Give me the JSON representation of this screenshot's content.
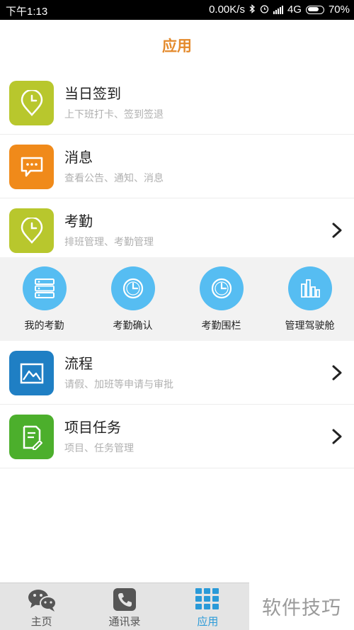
{
  "status_bar": {
    "time": "下午1:13",
    "network_speed": "0.00K/s",
    "network_type": "4G",
    "battery": "70%",
    "icons": [
      "bluetooth-icon",
      "alarm-icon",
      "signal-icon",
      "battery-icon"
    ]
  },
  "header": {
    "title": "应用"
  },
  "colors": {
    "title": "#e48a2c",
    "lime_icon": "#b8c72d",
    "orange_icon": "#f08a1a",
    "blue_icon": "#1f7fc4",
    "green_icon": "#4caf2c",
    "grid_circle": "#56bdf2",
    "nav_active": "#2a9ad8"
  },
  "list_top": [
    {
      "title": "当日签到",
      "subtitle": "上下班打卡、签到签退",
      "icon": "location-clock-icon",
      "has_chevron": false
    },
    {
      "title": "消息",
      "subtitle": "查看公告、通知、消息",
      "icon": "message-icon",
      "has_chevron": false
    },
    {
      "title": "考勤",
      "subtitle": "排班管理、考勤管理",
      "icon": "location-clock-icon",
      "has_chevron": true
    }
  ],
  "grid": [
    {
      "label": "我的考勤",
      "icon": "server-list-icon"
    },
    {
      "label": "考勤确认",
      "icon": "clock-icon"
    },
    {
      "label": "考勤围栏",
      "icon": "clock-icon"
    },
    {
      "label": "管理驾驶舱",
      "icon": "bar-chart-icon"
    }
  ],
  "list_bottom": [
    {
      "title": "流程",
      "subtitle": "请假、加班等申请与审批",
      "icon": "image-icon",
      "has_chevron": true
    },
    {
      "title": "项目任务",
      "subtitle": "项目、任务管理",
      "icon": "document-edit-icon",
      "has_chevron": true
    }
  ],
  "bottom_nav": [
    {
      "label": "主页",
      "icon": "wechat-chat-icon",
      "active": false
    },
    {
      "label": "通讯录",
      "icon": "phone-icon",
      "active": false
    },
    {
      "label": "应用",
      "icon": "grid-apps-icon",
      "active": true
    }
  ],
  "watermark": "软件技巧"
}
